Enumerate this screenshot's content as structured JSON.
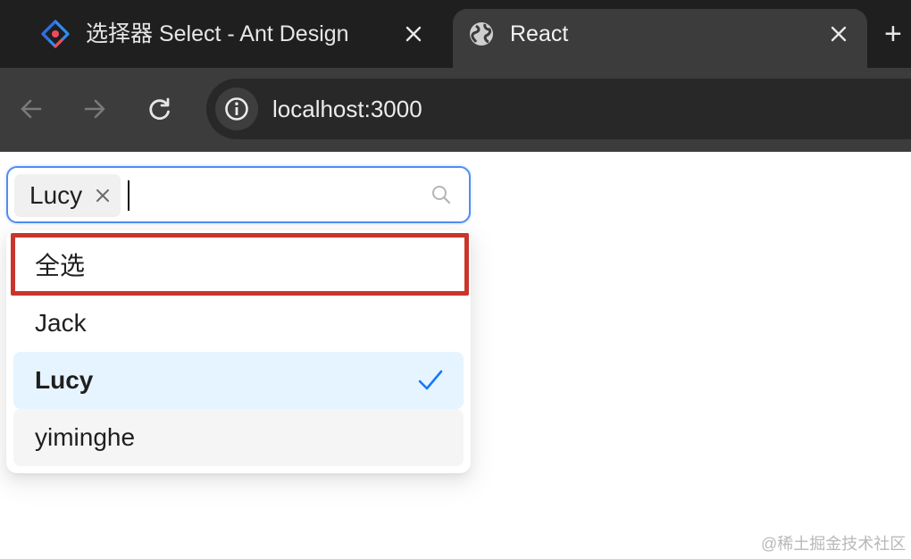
{
  "browser": {
    "tabs": [
      {
        "title": "选择器 Select - Ant Design",
        "icon": "ant-design-logo-icon",
        "active": false
      },
      {
        "title": "React",
        "icon": "globe-icon",
        "active": true
      }
    ],
    "address_bar": {
      "url": "localhost:3000",
      "icon": "info-icon"
    },
    "colors": {
      "tabbar": "#1f1f1f",
      "toolbar": "#3c3c3c",
      "omnibox": "#282828"
    }
  },
  "select": {
    "tags": [
      {
        "label": "Lucy"
      }
    ],
    "search_value": "",
    "colors": {
      "border": "#4f8df0"
    }
  },
  "dropdown": {
    "options": [
      {
        "label": "全选",
        "selected": false,
        "highlighted_by_annotation": true
      },
      {
        "label": "Jack",
        "selected": false
      },
      {
        "label": "Lucy",
        "selected": true
      },
      {
        "label": "yiminghe",
        "selected": false,
        "hovered": true
      }
    ],
    "colors": {
      "selected_bg": "#e6f4ff",
      "hover_bg": "#f5f5f5",
      "check": "#1677ff",
      "annotation_box": "#c9352b"
    }
  },
  "watermark": {
    "text": "@稀土掘金技术社区"
  }
}
